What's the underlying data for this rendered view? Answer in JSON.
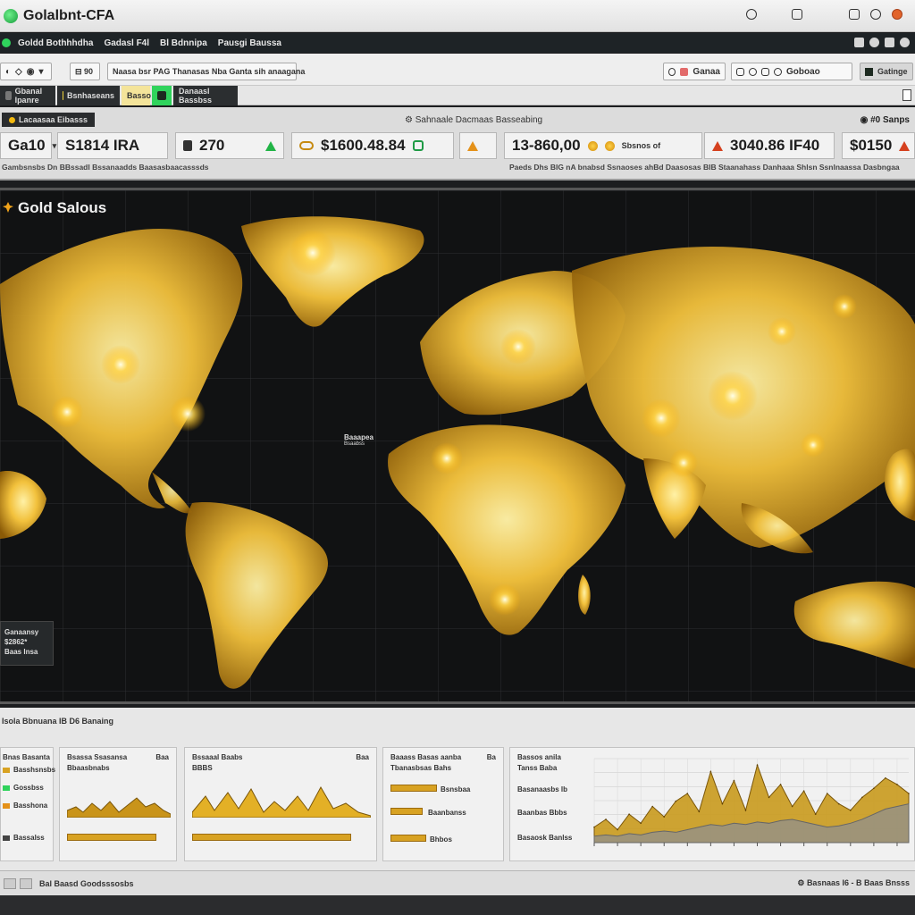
{
  "window": {
    "title": "Golalbnt-CFA"
  },
  "menubar": {
    "items": [
      "Goldd Bothhhdha",
      "Gadasl F4l",
      "Bl Bdnnipa",
      "Pausgi Baussa"
    ]
  },
  "toolbar": {
    "group1": [
      "◐",
      "◇",
      "◉",
      "▾"
    ],
    "group2": "⊟ 90",
    "group3": "Naasa bsr PAG  Thanasas  Nba Ganta sih anaagana",
    "group4": "Ganaa",
    "group5": "Goboao",
    "right_btn": "Gatinge"
  },
  "tabs": [
    "Gbanal Ipanre",
    "Bsnhaseans",
    "Basso",
    "Danaasl Bassbss"
  ],
  "status": {
    "pill": "Lacaasaa Eibasss",
    "center": "Sahnaale Dacmaas Basseabing",
    "right": "#0 Sanps"
  },
  "metrics": [
    {
      "value": "Ga10",
      "suffix": "▾"
    },
    {
      "value": "S1814 IRA"
    },
    {
      "value": "270"
    },
    {
      "value": "$1600.48.84"
    },
    {
      "value": "13-860,00"
    },
    {
      "value": "Sbsnos of",
      "small": true
    },
    {
      "value": "3040.86 IF40"
    },
    {
      "value": "$0150"
    }
  ],
  "sublines": {
    "left": "Gambsnsbs Dn BBssadl Bssanaadds Baasasbaacasssds",
    "right": "Paeds Dhs BIG nA bnabsd Ssnaoses ahBd Daasosas BIB  Staanahass Danhaaa Shlsn Ssnlnaassa Dasbngaa"
  },
  "map": {
    "title": "Gold Salous",
    "label_main": "Baaapea",
    "label_sub": "Bsaabss",
    "legend": [
      "Ganaansy",
      "$2862*",
      "Baas Insa"
    ]
  },
  "bottom": {
    "header": "Isola Bbnuana IB  D6 Banaing",
    "cards": [
      {
        "title": "Bnas Basanta",
        "rows": [
          "Basshsnsbs",
          "Gossbss",
          "Basshona",
          "Bassalss"
        ]
      },
      {
        "title": "Bsassa Ssasansa",
        "title_right": "Baa",
        "sub": "Bbaasbnabs"
      },
      {
        "title": "Bssaaal Baabs",
        "title_right": "Baa",
        "sub": "BBBS"
      },
      {
        "title": "Baaass Basas aanba",
        "title_right": "Ba",
        "sub": "Tbanasbsas Bahs",
        "rows": [
          "Bsnsbaa",
          "Baanbanss",
          "Bhbos"
        ]
      },
      {
        "title": "Bassos anila",
        "sub": "Tanss Baba",
        "rows": [
          "Basanaasbs lb",
          "Baanbas Bbbs",
          "Basaosk Banlss"
        ]
      }
    ],
    "footer_label": "Bal Baasd Goodsssosbs",
    "footer_right": "Basnaas I6 - B Baas Bnsss"
  },
  "chart_data": {
    "type": "area",
    "x": [
      1,
      2,
      3,
      4,
      5,
      6,
      7,
      8,
      9,
      10,
      11,
      12,
      13,
      14,
      15,
      16,
      17,
      18,
      19,
      20,
      21,
      22,
      23,
      24,
      25,
      26,
      27,
      28
    ],
    "series": [
      {
        "values": [
          12,
          18,
          10,
          22,
          15,
          28,
          20,
          32,
          38,
          24,
          55,
          30,
          48,
          25,
          60,
          35,
          45,
          28,
          40,
          22,
          38,
          30,
          25,
          35,
          42,
          50,
          45,
          38
        ]
      },
      {
        "values": [
          5,
          6,
          5,
          7,
          6,
          8,
          9,
          8,
          10,
          12,
          14,
          13,
          15,
          14,
          16,
          15,
          17,
          18,
          16,
          14,
          12,
          13,
          15,
          18,
          22,
          26,
          28,
          30
        ]
      }
    ],
    "colors": {
      "primary": "#c99a1d",
      "secondary": "#8f8f8f"
    },
    "grid": true
  },
  "colors": {
    "accent_gold": "#f3c23a",
    "accent_green": "#2fd35c",
    "panel_dark": "#161718"
  }
}
